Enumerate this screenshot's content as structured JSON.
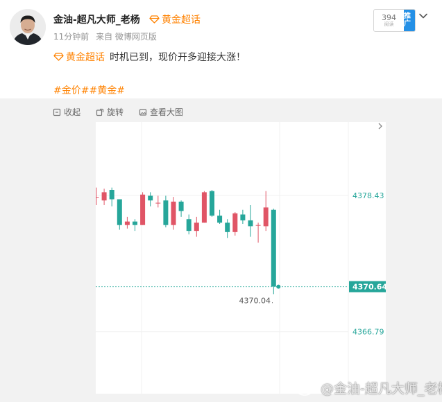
{
  "author": {
    "name": "金油-超凡大师_老杨",
    "topic_badge": "黄金超话",
    "time": "11分钟前",
    "source": "来自 微博网页版"
  },
  "push": {
    "count": "394",
    "sub": "阅读",
    "label": "推广"
  },
  "post": {
    "topic": "黄金超话",
    "text": "时机已到，现价开多迎接大涨！",
    "hashtags": "#金价##黄金#"
  },
  "toolbar": {
    "collapse": "收起",
    "rotate": "旋转",
    "view_large": "查看大图"
  },
  "watermark": "@金油-超凡大师_老杨",
  "colors": {
    "up": "#e05566",
    "down": "#26a69a",
    "accent": "#ff8200",
    "link_blue": "#2490e6"
  },
  "chart_data": {
    "type": "candlestick",
    "y_ticks": [
      "4378.43",
      "4366.79"
    ],
    "current_price": "4370.64",
    "low_marker": "4370.04",
    "ylim": [
      4361.5,
      4384.7
    ],
    "candles": [
      {
        "o": 4378.3,
        "h": 4379.1,
        "l": 4377.6,
        "c": 4378.3
      },
      {
        "o": 4378.0,
        "h": 4379.0,
        "l": 4377.6,
        "c": 4378.7
      },
      {
        "o": 4378.9,
        "h": 4379.1,
        "l": 4377.5,
        "c": 4378.1
      },
      {
        "o": 4378.1,
        "h": 4378.1,
        "l": 4375.5,
        "c": 4375.9
      },
      {
        "o": 4375.9,
        "h": 4376.6,
        "l": 4375.6,
        "c": 4376.2
      },
      {
        "o": 4376.2,
        "h": 4376.4,
        "l": 4375.4,
        "c": 4375.9
      },
      {
        "o": 4375.9,
        "h": 4378.7,
        "l": 4375.9,
        "c": 4378.5
      },
      {
        "o": 4378.4,
        "h": 4378.7,
        "l": 4377.5,
        "c": 4378.0
      },
      {
        "o": 4377.8,
        "h": 4378.4,
        "l": 4377.4,
        "c": 4377.8
      },
      {
        "o": 4378.0,
        "h": 4378.4,
        "l": 4375.7,
        "c": 4375.9
      },
      {
        "o": 4375.9,
        "h": 4378.3,
        "l": 4375.5,
        "c": 4377.9
      },
      {
        "o": 4377.9,
        "h": 4378.0,
        "l": 4376.6,
        "c": 4377.1
      },
      {
        "o": 4376.4,
        "h": 4376.8,
        "l": 4375.1,
        "c": 4375.4
      },
      {
        "o": 4375.4,
        "h": 4376.6,
        "l": 4374.9,
        "c": 4376.1
      },
      {
        "o": 4376.1,
        "h": 4378.8,
        "l": 4376.1,
        "c": 4378.7
      },
      {
        "o": 4378.8,
        "h": 4378.9,
        "l": 4376.6,
        "c": 4376.7
      },
      {
        "o": 4376.7,
        "h": 4377.2,
        "l": 4376.0,
        "c": 4376.1
      },
      {
        "o": 4376.1,
        "h": 4376.4,
        "l": 4374.8,
        "c": 4375.3
      },
      {
        "o": 4375.3,
        "h": 4377.0,
        "l": 4375.0,
        "c": 4376.9
      },
      {
        "o": 4376.8,
        "h": 4377.2,
        "l": 4376.0,
        "c": 4376.3
      },
      {
        "o": 4376.3,
        "h": 4377.6,
        "l": 4374.9,
        "c": 4375.8
      },
      {
        "o": 4375.9,
        "h": 4376.1,
        "l": 4374.4,
        "c": 4375.9
      },
      {
        "o": 4375.8,
        "h": 4378.8,
        "l": 4375.4,
        "c": 4377.4
      },
      {
        "o": 4377.2,
        "h": 4377.3,
        "l": 4370.0,
        "c": 4370.64
      }
    ]
  }
}
